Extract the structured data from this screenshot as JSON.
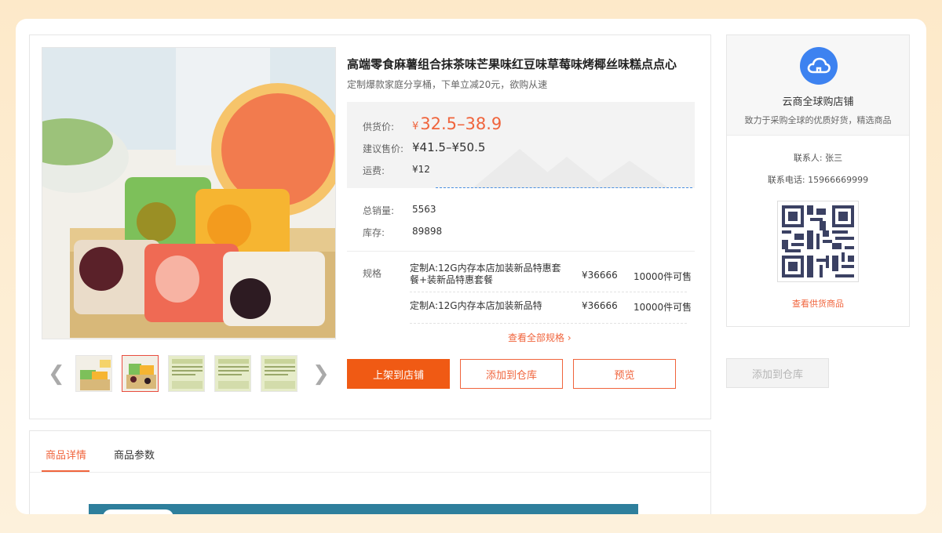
{
  "product": {
    "title": "高端零食麻薯组合抹茶味芒果味红豆味草莓味烤椰丝味糕点点心",
    "subtitle": "定制爆款家庭分享桶，下单立减20元，欲购从速",
    "supply_price_label": "供货价:",
    "supply_price_currency": "¥",
    "supply_price": "32.5–38.9",
    "retail_price_label": "建议售价:",
    "retail_price": "¥41.5–¥50.5",
    "shipping_label": "运费:",
    "shipping": "¥12",
    "sales_label": "总销量:",
    "sales": "5563",
    "stock_label": "库存:",
    "stock": "89898"
  },
  "specs": {
    "label": "规格",
    "items": [
      {
        "name": "定制A:12G内存本店加装新品特惠套餐+装新品特惠套餐",
        "price": "¥36666",
        "stock": "10000件可售"
      },
      {
        "name": "定制A:12G内存本店加装新品特",
        "price": "¥36666",
        "stock": "10000件可售"
      }
    ],
    "view_all": "查看全部规格"
  },
  "gallery": {
    "prev_arrow": "❮",
    "next_arrow": "❯",
    "thumb_count": 5,
    "active_thumb": 1
  },
  "actions": {
    "list_to_store": "上架到店铺",
    "add_to_warehouse": "添加到仓库",
    "preview": "预览"
  },
  "tabs": [
    {
      "label": "商品详情",
      "active": true
    },
    {
      "label": "商品参数",
      "active": false
    }
  ],
  "shop": {
    "name": "云商全球购店铺",
    "description": "致力于采购全球的优质好货，精选商品",
    "contact_label": "联系人:",
    "contact": "张三",
    "phone_label": "联系电话:",
    "phone": "15966669999",
    "view_goods": "查看供货商品",
    "logo_icon": "cloud-icon"
  },
  "side_action": {
    "add_to_warehouse": "添加到仓库",
    "disabled": true
  },
  "colors": {
    "accent": "#f0643c",
    "primary_button": "#f05a14",
    "shop_logo": "#3d82f0"
  }
}
